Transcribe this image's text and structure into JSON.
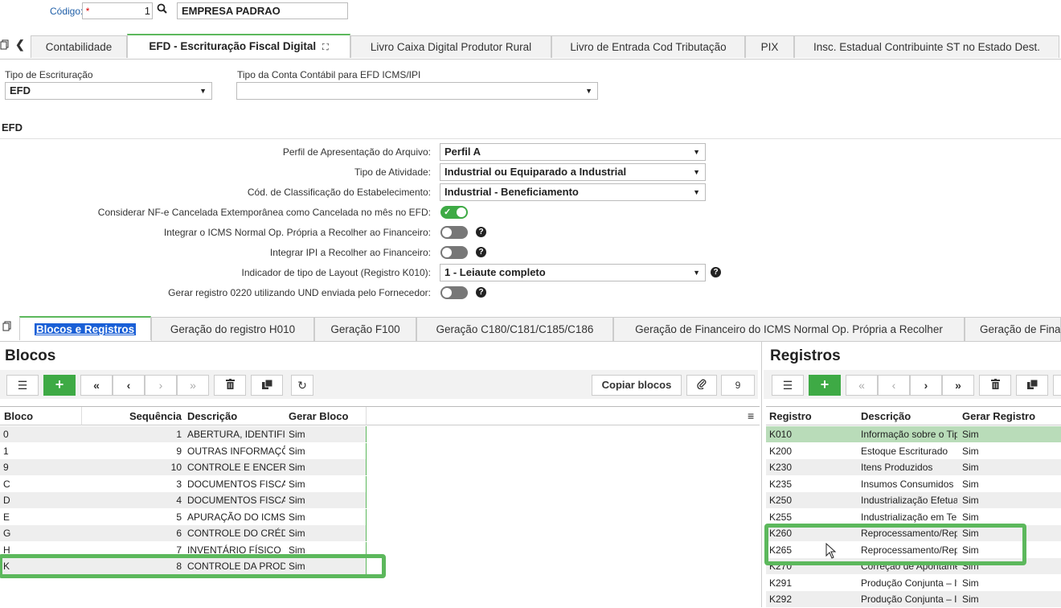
{
  "header": {
    "codigo_label": "Código:",
    "required_mark": "*",
    "codigo_value": "1",
    "empresa_value": "EMPRESA PADRAO"
  },
  "top_tabs": [
    {
      "label": "Contabilidade"
    },
    {
      "label": "EFD - Escrituração Fiscal Digital"
    },
    {
      "label": "Livro Caixa Digital Produtor Rural"
    },
    {
      "label": "Livro de Entrada Cod Tributação"
    },
    {
      "label": "PIX"
    },
    {
      "label": "Insc. Estadual Contribuinte ST no Estado Dest."
    }
  ],
  "fields": {
    "tipo_escrituracao_label": "Tipo de Escrituração",
    "tipo_escrituracao_value": "EFD",
    "tipo_conta_label": "Tipo da Conta Contábil para EFD ICMS/IPI",
    "tipo_conta_value": ""
  },
  "efd": {
    "title": "EFD",
    "perfil_label": "Perfil de Apresentação do Arquivo:",
    "perfil_value": "Perfil A",
    "atividade_label": "Tipo de Atividade:",
    "atividade_value": "Industrial ou Equiparado a Industrial",
    "classificacao_label": "Cód. de Classificação do Estabelecimento:",
    "classificacao_value": "Industrial - Beneficiamento",
    "nfe_label": "Considerar NF-e Cancelada Extemporânea como Cancelada no mês no EFD:",
    "icms_label": "Integrar o ICMS Normal Op. Própria a Recolher ao Financeiro:",
    "ipi_label": "Integrar IPI a Recolher ao Financeiro:",
    "layout_label": "Indicador de tipo de Layout (Registro K010):",
    "layout_value": "1 - Leiaute completo",
    "reg0220_label": "Gerar registro 0220 utilizando UND enviada pelo Fornecedor:",
    "help_glyph": "?"
  },
  "bottom_tabs": [
    {
      "label": "Blocos e Registros"
    },
    {
      "label": "Geração do registro H010"
    },
    {
      "label": "Geração F100"
    },
    {
      "label": "Geração C180/C181/C185/C186"
    },
    {
      "label": "Geração de Financeiro do ICMS Normal Op. Própria a Recolher"
    },
    {
      "label": "Geração de Fina"
    }
  ],
  "blocos": {
    "title": "Blocos",
    "copiar_label": "Copiar blocos",
    "count": "9",
    "columns": [
      "Bloco",
      "Sequência",
      "Descrição",
      "Gerar Bloco"
    ],
    "rows": [
      {
        "bloco": "0",
        "seq": "1",
        "desc": "ABERTURA, IDENTIFICAÇÃO",
        "gerar": "Sim"
      },
      {
        "bloco": "1",
        "seq": "9",
        "desc": "OUTRAS INFORMAÇÕES",
        "gerar": "Sim"
      },
      {
        "bloco": "9",
        "seq": "10",
        "desc": "CONTROLE E ENCERRAMENTO",
        "gerar": "Sim"
      },
      {
        "bloco": "C",
        "seq": "3",
        "desc": "DOCUMENTOS FISCAIS I",
        "gerar": "Sim"
      },
      {
        "bloco": "D",
        "seq": "4",
        "desc": "DOCUMENTOS FISCAIS II",
        "gerar": "Sim"
      },
      {
        "bloco": "E",
        "seq": "5",
        "desc": "APURAÇÃO DO ICMS E DO IPI",
        "gerar": "Sim"
      },
      {
        "bloco": "G",
        "seq": "6",
        "desc": "CONTROLE DO CRÉDITO",
        "gerar": "Sim"
      },
      {
        "bloco": "H",
        "seq": "7",
        "desc": "INVENTÁRIO FÍSICO",
        "gerar": "Sim"
      },
      {
        "bloco": "K",
        "seq": "8",
        "desc": "CONTROLE DA PRODUÇÃO",
        "gerar": "Sim"
      }
    ]
  },
  "registros": {
    "title": "Registros",
    "columns": [
      "Registro",
      "Descrição",
      "Gerar Registro"
    ],
    "rows": [
      {
        "reg": "K010",
        "desc": "Informação sobre o Tipo",
        "gerar": "Sim"
      },
      {
        "reg": "K200",
        "desc": "Estoque Escriturado",
        "gerar": "Sim"
      },
      {
        "reg": "K230",
        "desc": "Itens Produzidos",
        "gerar": "Sim"
      },
      {
        "reg": "K235",
        "desc": "Insumos Consumidos",
        "gerar": "Sim"
      },
      {
        "reg": "K250",
        "desc": "Industrialização Efetuada",
        "gerar": "Sim"
      },
      {
        "reg": "K255",
        "desc": "Industrialização em Terceiros",
        "gerar": "Sim"
      },
      {
        "reg": "K260",
        "desc": "Reprocessamento/Reparo",
        "gerar": "Sim"
      },
      {
        "reg": "K265",
        "desc": "Reprocessamento/Reparo",
        "gerar": "Sim"
      },
      {
        "reg": "K270",
        "desc": "Correção de Apontamento",
        "gerar": "Sim"
      },
      {
        "reg": "K291",
        "desc": "Produção Conjunta – Itens",
        "gerar": "Sim"
      },
      {
        "reg": "K292",
        "desc": "Produção Conjunta – Insumos",
        "gerar": "Sim"
      }
    ]
  }
}
